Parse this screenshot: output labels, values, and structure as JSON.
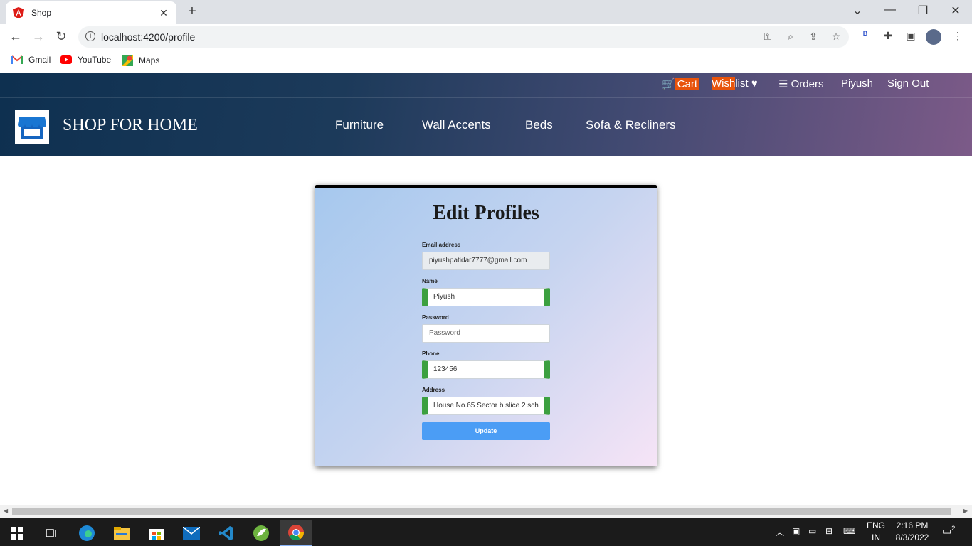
{
  "browser": {
    "tab_title": "Shop",
    "url": "localhost:4200/profile",
    "bookmarks": [
      {
        "label": "Gmail",
        "icon": "gmail-icon"
      },
      {
        "label": "YouTube",
        "icon": "youtube-icon"
      },
      {
        "label": "Maps",
        "icon": "maps-icon"
      }
    ]
  },
  "header": {
    "top_links": {
      "cart": "Cart",
      "wishlist_highlight": "Wish",
      "wishlist_rest": "list",
      "orders": "Orders",
      "user": "Piyush",
      "signout": "Sign Out"
    },
    "brand": "SHOP FOR HOME",
    "nav": [
      "Furniture",
      "Wall Accents",
      "Beds",
      "Sofa & Recliners"
    ]
  },
  "form": {
    "title": "Edit Profiles",
    "email_label": "Email address",
    "email_value": "piyushpatidar7777@gmail.com",
    "name_label": "Name",
    "name_value": "Piyush",
    "password_label": "Password",
    "password_placeholder": "Password",
    "phone_label": "Phone",
    "phone_value": "123456",
    "address_label": "Address",
    "address_value": "House No.65 Sector b slice 2 sch",
    "update_label": "Update"
  },
  "taskbar": {
    "lang_line1": "ENG",
    "lang_line2": "IN",
    "time": "2:16 PM",
    "date": "8/3/2022",
    "notifications": "2"
  },
  "colors": {
    "accent_orange": "#e8540c",
    "valid_green": "#3ca040",
    "button_blue": "#4b9df5"
  }
}
